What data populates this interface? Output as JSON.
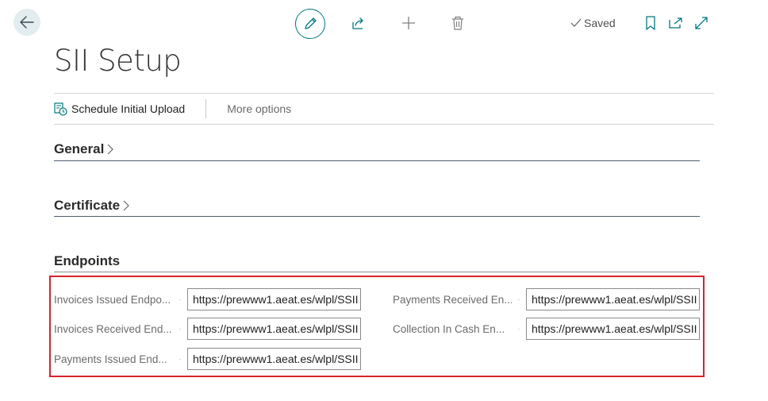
{
  "toolbar": {
    "back_icon": "arrow-left-icon",
    "edit_icon": "pencil-icon",
    "share_icon": "share-icon",
    "new_icon": "plus-icon",
    "delete_icon": "trash-icon",
    "saved_label": "Saved",
    "bookmark_icon": "bookmark-icon",
    "open_new_icon": "open-in-new-window-icon",
    "expand_icon": "expand-icon"
  },
  "page": {
    "title": "SII Setup"
  },
  "actions": {
    "schedule_upload_label": "Schedule Initial Upload",
    "more_options_label": "More options"
  },
  "sections": {
    "general": "General",
    "certificate": "Certificate",
    "endpoints": "Endpoints"
  },
  "endpoints": {
    "invoices_issued": {
      "label": "Invoices Issued Endpo...",
      "value": "https://prewww1.aeat.es/wlpl/SSII"
    },
    "invoices_received": {
      "label": "Invoices Received End...",
      "value": "https://prewww1.aeat.es/wlpl/SSII"
    },
    "payments_issued": {
      "label": "Payments Issued End...",
      "value": "https://prewww1.aeat.es/wlpl/SSII"
    },
    "payments_received": {
      "label": "Payments Received En...",
      "value": "https://prewww1.aeat.es/wlpl/SSII"
    },
    "collection_in_cash": {
      "label": "Collection In Cash En...",
      "value": "https://prewww1.aeat.es/wlpl/SSII"
    }
  },
  "colors": {
    "accent": "#00787d",
    "highlight": "#d9242c",
    "back_button_bg": "#e3edef"
  }
}
